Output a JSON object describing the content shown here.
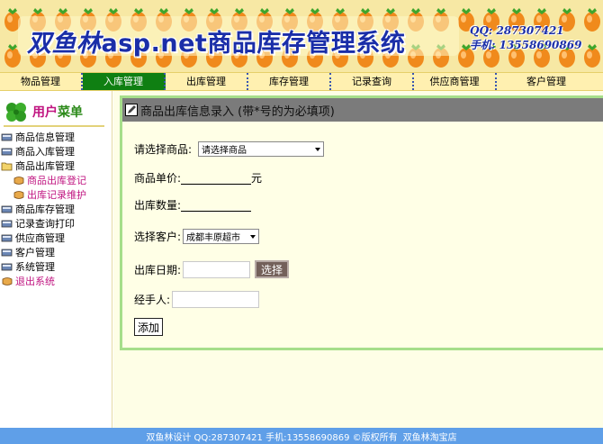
{
  "banner": {
    "brand": "双鱼林",
    "title": "asp.net商品库存管理系统",
    "qq_line": "QQ: 287307421",
    "phone_line": "手机: 13558690869"
  },
  "nav": {
    "items": [
      {
        "label": "物品管理",
        "active": false
      },
      {
        "label": "入库管理",
        "active": true
      },
      {
        "label": "出库管理",
        "active": false
      },
      {
        "label": "库存管理",
        "active": false
      },
      {
        "label": "记录查询",
        "active": false
      },
      {
        "label": "供应商管理",
        "active": false
      },
      {
        "label": "客户管理",
        "active": false
      }
    ]
  },
  "sidebar": {
    "title_part1": "用户",
    "title_part2": "菜单",
    "items": [
      {
        "label": "商品信息管理",
        "level": 1,
        "icon": "book-icon"
      },
      {
        "label": "商品入库管理",
        "level": 1,
        "icon": "book-icon"
      },
      {
        "label": "商品出库管理",
        "level": 1,
        "icon": "open-folder-icon"
      },
      {
        "label": "商品出库登记",
        "level": 2,
        "icon": "scroll-icon"
      },
      {
        "label": "出库记录维护",
        "level": 2,
        "icon": "scroll-icon"
      },
      {
        "label": "商品库存管理",
        "level": 1,
        "icon": "book-icon"
      },
      {
        "label": "记录查询打印",
        "level": 1,
        "icon": "book-icon"
      },
      {
        "label": "供应商管理",
        "level": 1,
        "icon": "book-icon"
      },
      {
        "label": "客户管理",
        "level": 1,
        "icon": "book-icon"
      },
      {
        "label": "系统管理",
        "level": 1,
        "icon": "book-icon"
      },
      {
        "label": "退出系统",
        "level": 1,
        "icon": "scroll-icon"
      }
    ]
  },
  "form": {
    "heading": "商品出库信息录入 (带*号的为必填项)",
    "product_label": "请选择商品:",
    "product_selected": "请选择商品",
    "price_label": "商品单价:",
    "price_value": "",
    "price_unit": "元",
    "qty_label": "出库数量:",
    "qty_value": "",
    "customer_label": "选择客户:",
    "customer_selected": "成都丰原超市",
    "date_label": "出库日期:",
    "date_value": "",
    "date_button": "选择",
    "handler_label": "经手人:",
    "handler_value": "",
    "submit_label": "添加"
  },
  "footer": {
    "text": "双鱼林设计  QQ:287307421 手机:13558690869 ©版权所有",
    "shop_link": "双鱼林淘宝店"
  },
  "colors": {
    "nav_active": "#0f7f12",
    "banner_title": "#1a2ea8",
    "panel_border": "#a6de8a",
    "panel_header": "#7b7b7b",
    "footer": "#5f9fe8",
    "submenu": "#c01480"
  }
}
